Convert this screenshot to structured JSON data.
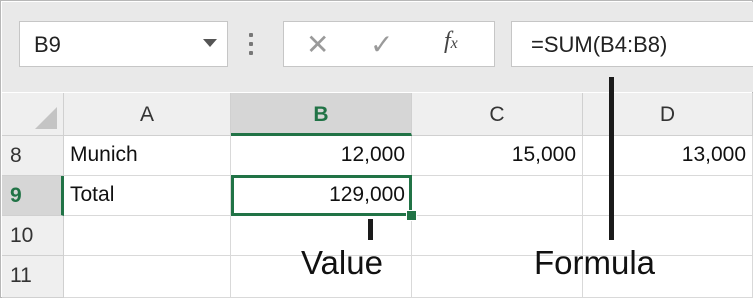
{
  "name_box": {
    "value": "B9"
  },
  "formula_bar": {
    "cancel_glyph": "✕",
    "enter_glyph": "✓",
    "function_glyph": "fx",
    "formula": "=SUM(B4:B8)"
  },
  "columns": [
    {
      "label": "A",
      "selected": false
    },
    {
      "label": "B",
      "selected": true
    },
    {
      "label": "C",
      "selected": false
    },
    {
      "label": "D",
      "selected": false
    }
  ],
  "rows": [
    {
      "header": "8",
      "selected": false,
      "cells": [
        "Munich",
        "12,000",
        "15,000",
        "13,000"
      ]
    },
    {
      "header": "9",
      "selected": true,
      "cells": [
        "Total",
        "129,000",
        "",
        ""
      ]
    },
    {
      "header": "10",
      "selected": false,
      "cells": [
        "",
        "",
        "",
        ""
      ]
    },
    {
      "header": "11",
      "selected": false,
      "cells": [
        "",
        "",
        "",
        ""
      ]
    }
  ],
  "annotations": {
    "value_label": "Value",
    "formula_label": "Formula"
  },
  "colors": {
    "accent": "#217346"
  },
  "icons": {
    "dropdown": "chevron-down-icon",
    "cancel": "close-icon",
    "enter": "checkmark-icon",
    "function": "insert-function-icon"
  }
}
